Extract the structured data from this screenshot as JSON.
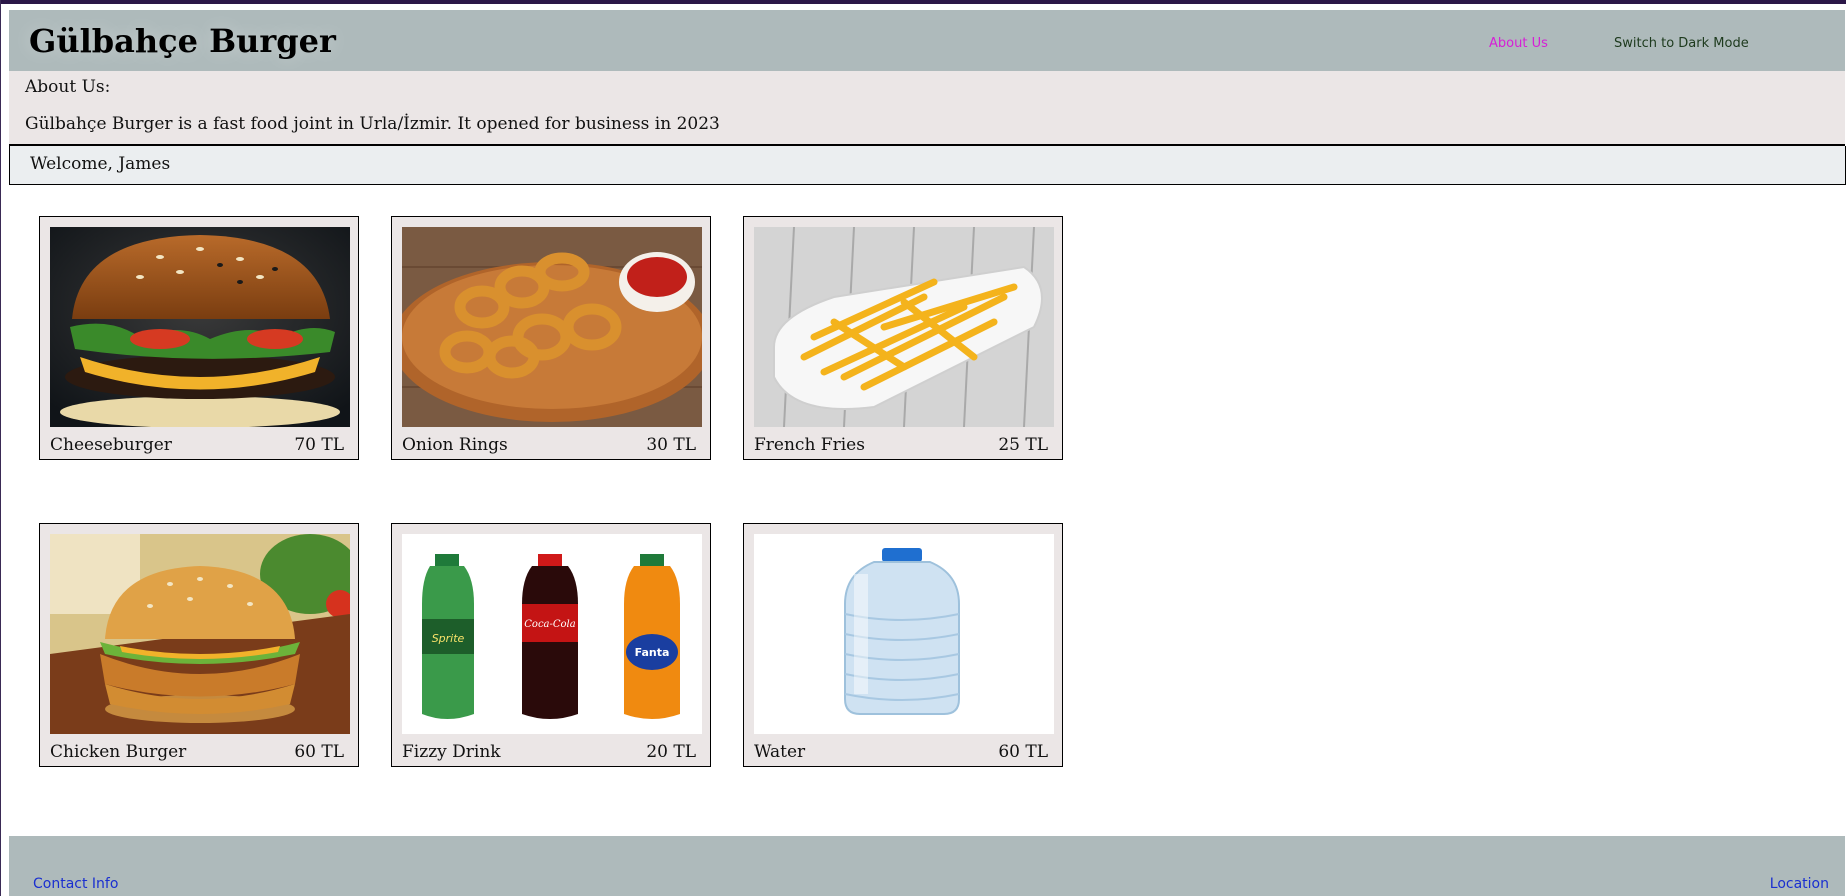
{
  "header": {
    "title": "Gülbahçe Burger",
    "nav": {
      "about_label": "About Us",
      "dark_mode_label": "Switch to Dark Mode"
    }
  },
  "about": {
    "title": "About Us:",
    "text": "Gülbahçe Burger is a fast food joint in Urla/İzmir. It opened for business in 2023"
  },
  "welcome": {
    "text": "Welcome, James"
  },
  "menu": {
    "items": [
      {
        "name": "Cheeseburger",
        "price": "70 TL",
        "image": "cheeseburger-photo"
      },
      {
        "name": "Onion Rings",
        "price": "30 TL",
        "image": "onion-rings-photo"
      },
      {
        "name": "French Fries",
        "price": "25 TL",
        "image": "french-fries-photo"
      },
      {
        "name": "Chicken Burger",
        "price": "60 TL",
        "image": "chicken-burger-photo"
      },
      {
        "name": "Fizzy Drink",
        "price": "20 TL",
        "image": "fizzy-drinks-photo"
      },
      {
        "name": "Water",
        "price": "60 TL",
        "image": "water-bottle-photo"
      }
    ]
  },
  "drinks": {
    "labels": [
      "Sprite",
      "Coca-Cola",
      "Fanta"
    ]
  },
  "footer": {
    "contact_label": "Contact Info",
    "location_label": "Location"
  },
  "colors": {
    "header_bg": "#aebabb",
    "about_link": "#d61fd6",
    "footer_link": "#1a2fd0",
    "card_bg": "#ebe6e6"
  }
}
